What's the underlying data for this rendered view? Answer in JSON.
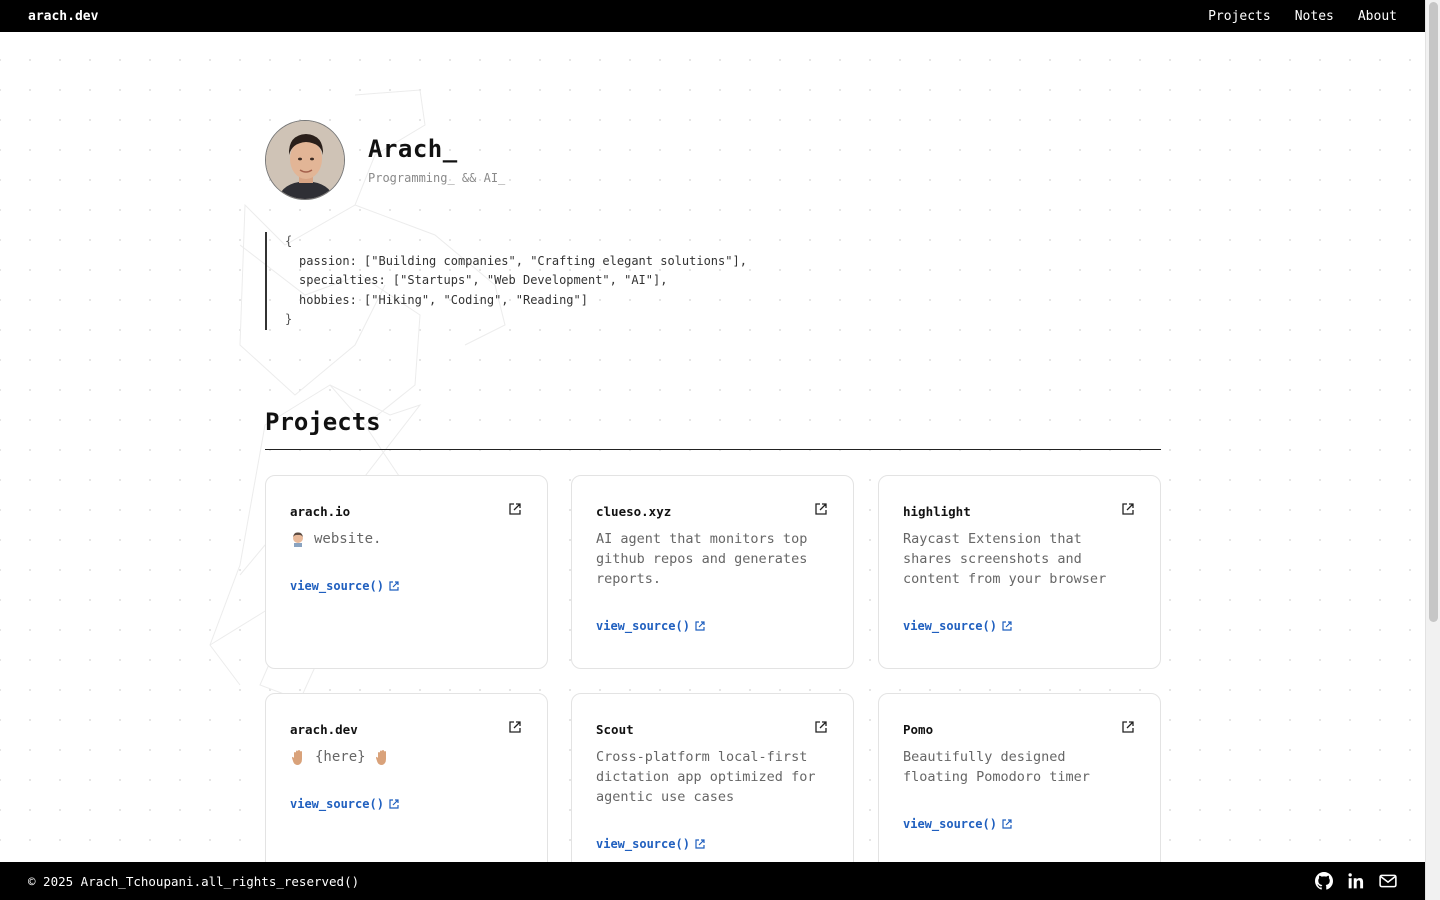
{
  "navbar": {
    "brand": "arach.dev",
    "links": [
      "Projects",
      "Notes",
      "About"
    ]
  },
  "profile": {
    "name": "Arach_",
    "tagline": "Programming_ && AI_"
  },
  "code": {
    "open": "{",
    "lines": [
      "passion: [\"Building companies\", \"Crafting elegant solutions\"],",
      "specialties: [\"Startups\", \"Web Development\", \"AI\"],",
      "hobbies: [\"Hiking\", \"Coding\", \"Reading\"]"
    ],
    "close": "}"
  },
  "projects_section": {
    "title": "Projects",
    "link_label": "view_source()",
    "cards": [
      {
        "title": "arach.io",
        "desc": "website.",
        "emoji": "person-avatar"
      },
      {
        "title": "clueso.xyz",
        "desc": "AI agent that monitors top github repos and generates reports."
      },
      {
        "title": "highlight",
        "desc": "Raycast Extension that shares screenshots and content from your browser"
      },
      {
        "title": "arach.dev",
        "desc": "{here}",
        "emoji": "raised-hand"
      },
      {
        "title": "Scout",
        "desc": "Cross-platform local-first dictation app optimized for agentic use cases"
      },
      {
        "title": "Pomo",
        "desc": "Beautifully designed floating Pomodoro timer"
      }
    ]
  },
  "footer": {
    "copyright": "© 2025 Arach_Tchoupani.all_rights_reserved()",
    "socials": [
      "github-icon",
      "linkedin-icon",
      "mail-icon"
    ]
  },
  "colors": {
    "link": "#1f5fbf",
    "bar": "#000000"
  }
}
